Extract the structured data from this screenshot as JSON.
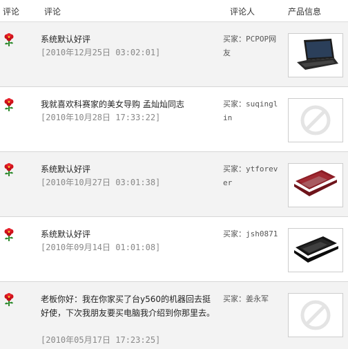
{
  "header": {
    "col1": "评论",
    "col2": "评论",
    "col3": "评论人",
    "col4": "产品信息"
  },
  "reviews": [
    {
      "comment": "系统默认好评",
      "date": "[2010年12月25日 03:02:01]",
      "reviewer": "买家：PCPOP网友",
      "product_icon": "laptop-black-icon"
    },
    {
      "comment": "我就喜欢科赛家的美女导购 孟灿灿同志",
      "date": "[2010年10月28日 17:33:22]",
      "reviewer": "买家：suqinglin",
      "product_icon": "no-image-icon"
    },
    {
      "comment": "系统默认好评",
      "date": "[2010年10月27日 03:01:38]",
      "reviewer": "买家：ytforever",
      "product_icon": "laptop-red-icon"
    },
    {
      "comment": "系统默认好评",
      "date": "[2010年09月14日 01:01:08]",
      "reviewer": "买家：jsh0871",
      "product_icon": "laptop-black-icon"
    },
    {
      "comment": "老板你好：我在你家买了台y560的机器回去挺好使，下次我朋友要买电脑我介绍到你那里去。",
      "date": "[2010年05月17日 17:23:25]",
      "reviewer": "买家：姜永军",
      "product_icon": "no-image-icon"
    }
  ]
}
